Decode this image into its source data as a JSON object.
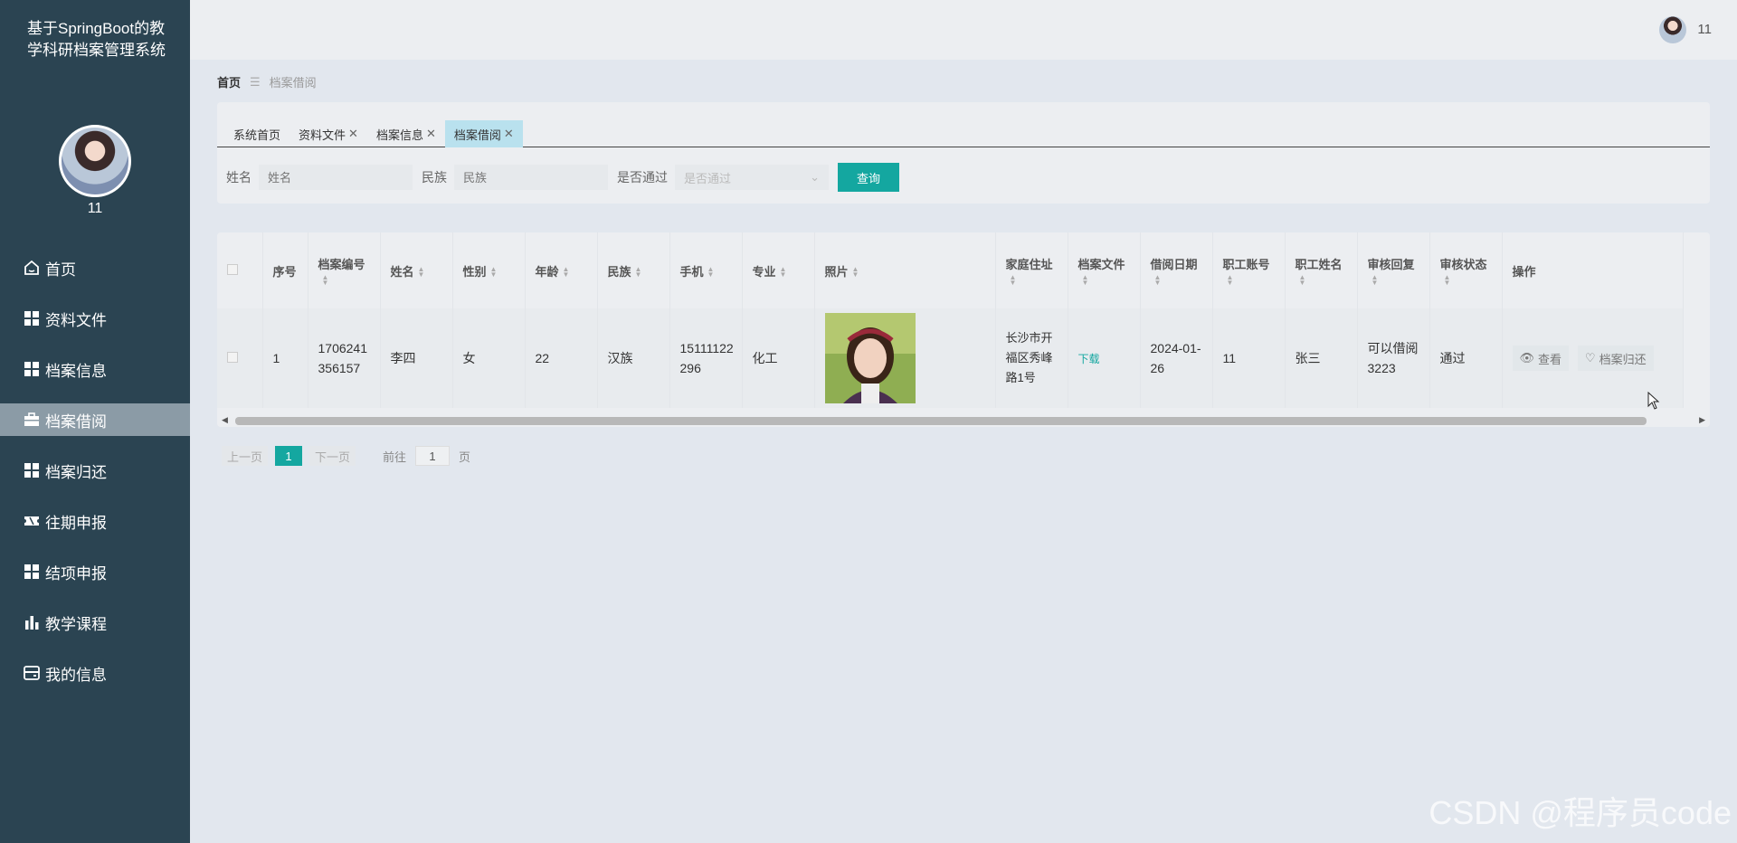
{
  "app": {
    "title": "基于SpringBoot的教学科研档案管理系统",
    "username": "11"
  },
  "header": {
    "username": "11"
  },
  "breadcrumb": {
    "home": "首页",
    "separator": "☰",
    "current": "档案借阅"
  },
  "sidebar": {
    "items": [
      {
        "label": "首页",
        "icon": "home-icon"
      },
      {
        "label": "资料文件",
        "icon": "grid-icon"
      },
      {
        "label": "档案信息",
        "icon": "grid-icon"
      },
      {
        "label": "档案借阅",
        "icon": "briefcase-icon",
        "active": true
      },
      {
        "label": "档案归还",
        "icon": "grid-icon"
      },
      {
        "label": "往期申报",
        "icon": "ticket-icon"
      },
      {
        "label": "结项申报",
        "icon": "grid-icon"
      },
      {
        "label": "教学课程",
        "icon": "bar-chart-icon"
      },
      {
        "label": "我的信息",
        "icon": "wallet-icon"
      }
    ]
  },
  "tabs": [
    {
      "label": "系统首页",
      "closable": false
    },
    {
      "label": "资料文件",
      "closable": true
    },
    {
      "label": "档案信息",
      "closable": true
    },
    {
      "label": "档案借阅",
      "closable": true,
      "active": true
    }
  ],
  "search": {
    "name_label": "姓名",
    "name_placeholder": "姓名",
    "ethnic_label": "民族",
    "ethnic_placeholder": "民族",
    "pass_label": "是否通过",
    "pass_placeholder": "是否通过",
    "query_button": "查询"
  },
  "table": {
    "columns": [
      "序号",
      "档案编号",
      "姓名",
      "性别",
      "年龄",
      "民族",
      "手机",
      "专业",
      "照片",
      "家庭住址",
      "档案文件",
      "借阅日期",
      "职工账号",
      "职工姓名",
      "审核回复",
      "审核状态",
      "操作"
    ],
    "rows": [
      {
        "index": "1",
        "archive_no": "1706241356157",
        "name": "李四",
        "gender": "女",
        "age": "22",
        "ethnic": "汉族",
        "phone": "15111122296",
        "major": "化工",
        "address": "长沙市开福区秀峰路1号",
        "file": "下载",
        "borrow_date": "2024-01-26",
        "staff_account": "11",
        "staff_name": "张三",
        "reply": "可以借阅3223",
        "status": "通过",
        "action_view": "查看",
        "action_return": "档案归还"
      }
    ]
  },
  "pagination": {
    "prev": "上一页",
    "page": "1",
    "next": "下一页",
    "goto_label": "前往",
    "goto_value": "1",
    "page_suffix": "页"
  },
  "watermark": "CSDN @程序员code",
  "colors": {
    "sidebar": "#2b4452",
    "accent": "#14a7a0",
    "active_tab": "#b9e1ee"
  }
}
